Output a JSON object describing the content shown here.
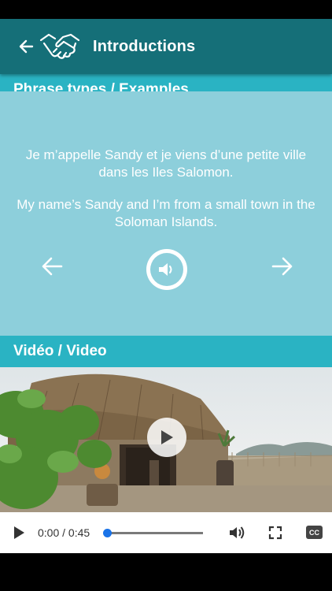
{
  "app_bar": {
    "title": "Introductions",
    "back_icon": "arrow-left-icon",
    "logo_icon": "handshake-icon",
    "color": "#156f78"
  },
  "phrase_section": {
    "header": "Phrase types / Examples",
    "header_color": "#2ab3c3",
    "background": "#8dcfdb",
    "french": "Je m’appelle Sandy et je viens d’une petite ville dans les Iles Salomon.",
    "english": "My name’s Sandy and I’m from a small town in the Soloman Islands.",
    "prev_icon": "arrow-left-icon",
    "next_icon": "arrow-right-icon",
    "audio_icon": "speaker-icon"
  },
  "video_section": {
    "header": "Vidéo / Video",
    "play_icon": "play-icon",
    "controls": {
      "time": "0:00 / 0:45",
      "progress": 0.0,
      "play_icon": "play-icon",
      "volume_icon": "volume-icon",
      "fullscreen_icon": "fullscreen-icon",
      "cc_label": "CC"
    }
  }
}
